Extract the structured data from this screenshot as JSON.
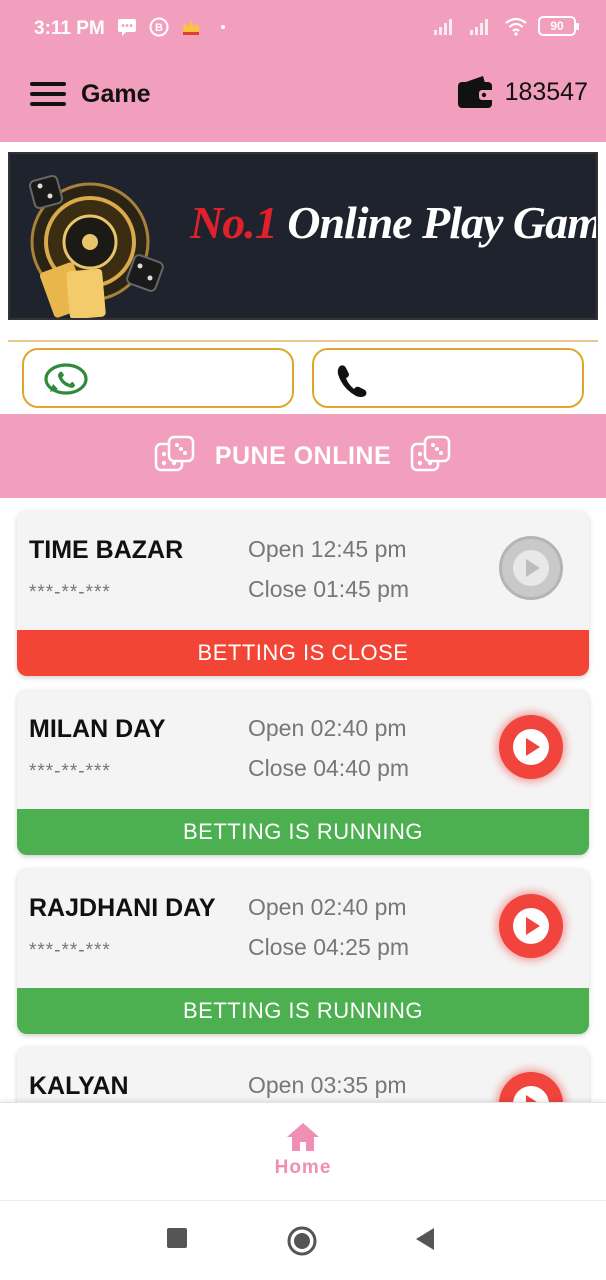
{
  "status_bar": {
    "time": "3:11 PM",
    "battery": "90",
    "icons": [
      "message-icon",
      "b-badge-icon",
      "crown-icon",
      "dot-icon",
      "signal-icon",
      "signal-icon",
      "wifi-icon",
      "battery-icon"
    ]
  },
  "app_bar": {
    "title": "Game",
    "wallet_balance": "183547"
  },
  "banner": {
    "text_red": "No.1",
    "text_white": " Online Play Games"
  },
  "contact": {
    "whatsapp_icon": "whatsapp-icon",
    "phone_icon": "phone-icon"
  },
  "section": {
    "title": "PUNE ONLINE"
  },
  "colors": {
    "accent": "#f29fbd",
    "closed": "#f24536",
    "running": "#4caf50",
    "play": "#f0443d"
  },
  "games": [
    {
      "name": "TIME BAZAR",
      "result": "***-**-***",
      "open": "Open 12:45 pm",
      "close": "Close 01:45 pm",
      "status": "BETTING IS CLOSE",
      "state": "closed"
    },
    {
      "name": "MILAN DAY",
      "result": "***-**-***",
      "open": "Open 02:40 pm",
      "close": "Close 04:40 pm",
      "status": "BETTING IS RUNNING",
      "state": "running"
    },
    {
      "name": "RAJDHANI DAY",
      "result": "***-**-***",
      "open": "Open 02:40 pm",
      "close": "Close 04:25 pm",
      "status": "BETTING IS RUNNING",
      "state": "running"
    },
    {
      "name": "KALYAN",
      "open": "Open 03:35 pm"
    }
  ],
  "bottom_nav": {
    "home_label": "Home"
  }
}
